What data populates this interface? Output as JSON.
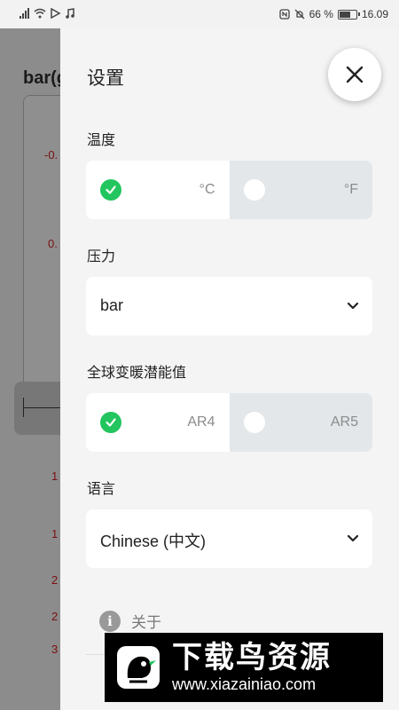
{
  "status_bar": {
    "battery": "66 %",
    "time": "16.09"
  },
  "background_app": {
    "title": "bar(g",
    "numbers": [
      "-0.",
      "0.",
      "1",
      "1",
      "2",
      "2",
      "3"
    ]
  },
  "settings": {
    "title": "设置",
    "temperature": {
      "label": "温度",
      "options": [
        "°C",
        "°F"
      ],
      "selected": "°C"
    },
    "pressure": {
      "label": "压力",
      "value": "bar"
    },
    "gwp": {
      "label": "全球变暖潜能值",
      "options": [
        "AR4",
        "AR5"
      ],
      "selected": "AR4"
    },
    "language": {
      "label": "语言",
      "value": "Chinese (中文)"
    },
    "about": {
      "label": "关于",
      "icon": "i"
    }
  },
  "watermark": {
    "text": "下载鸟资源",
    "url": "www.xiazainiao.com"
  },
  "colors": {
    "accent_green": "#22c55e",
    "panel_bg": "#f4f4f4",
    "unselected_bg": "#e3e7ea"
  }
}
